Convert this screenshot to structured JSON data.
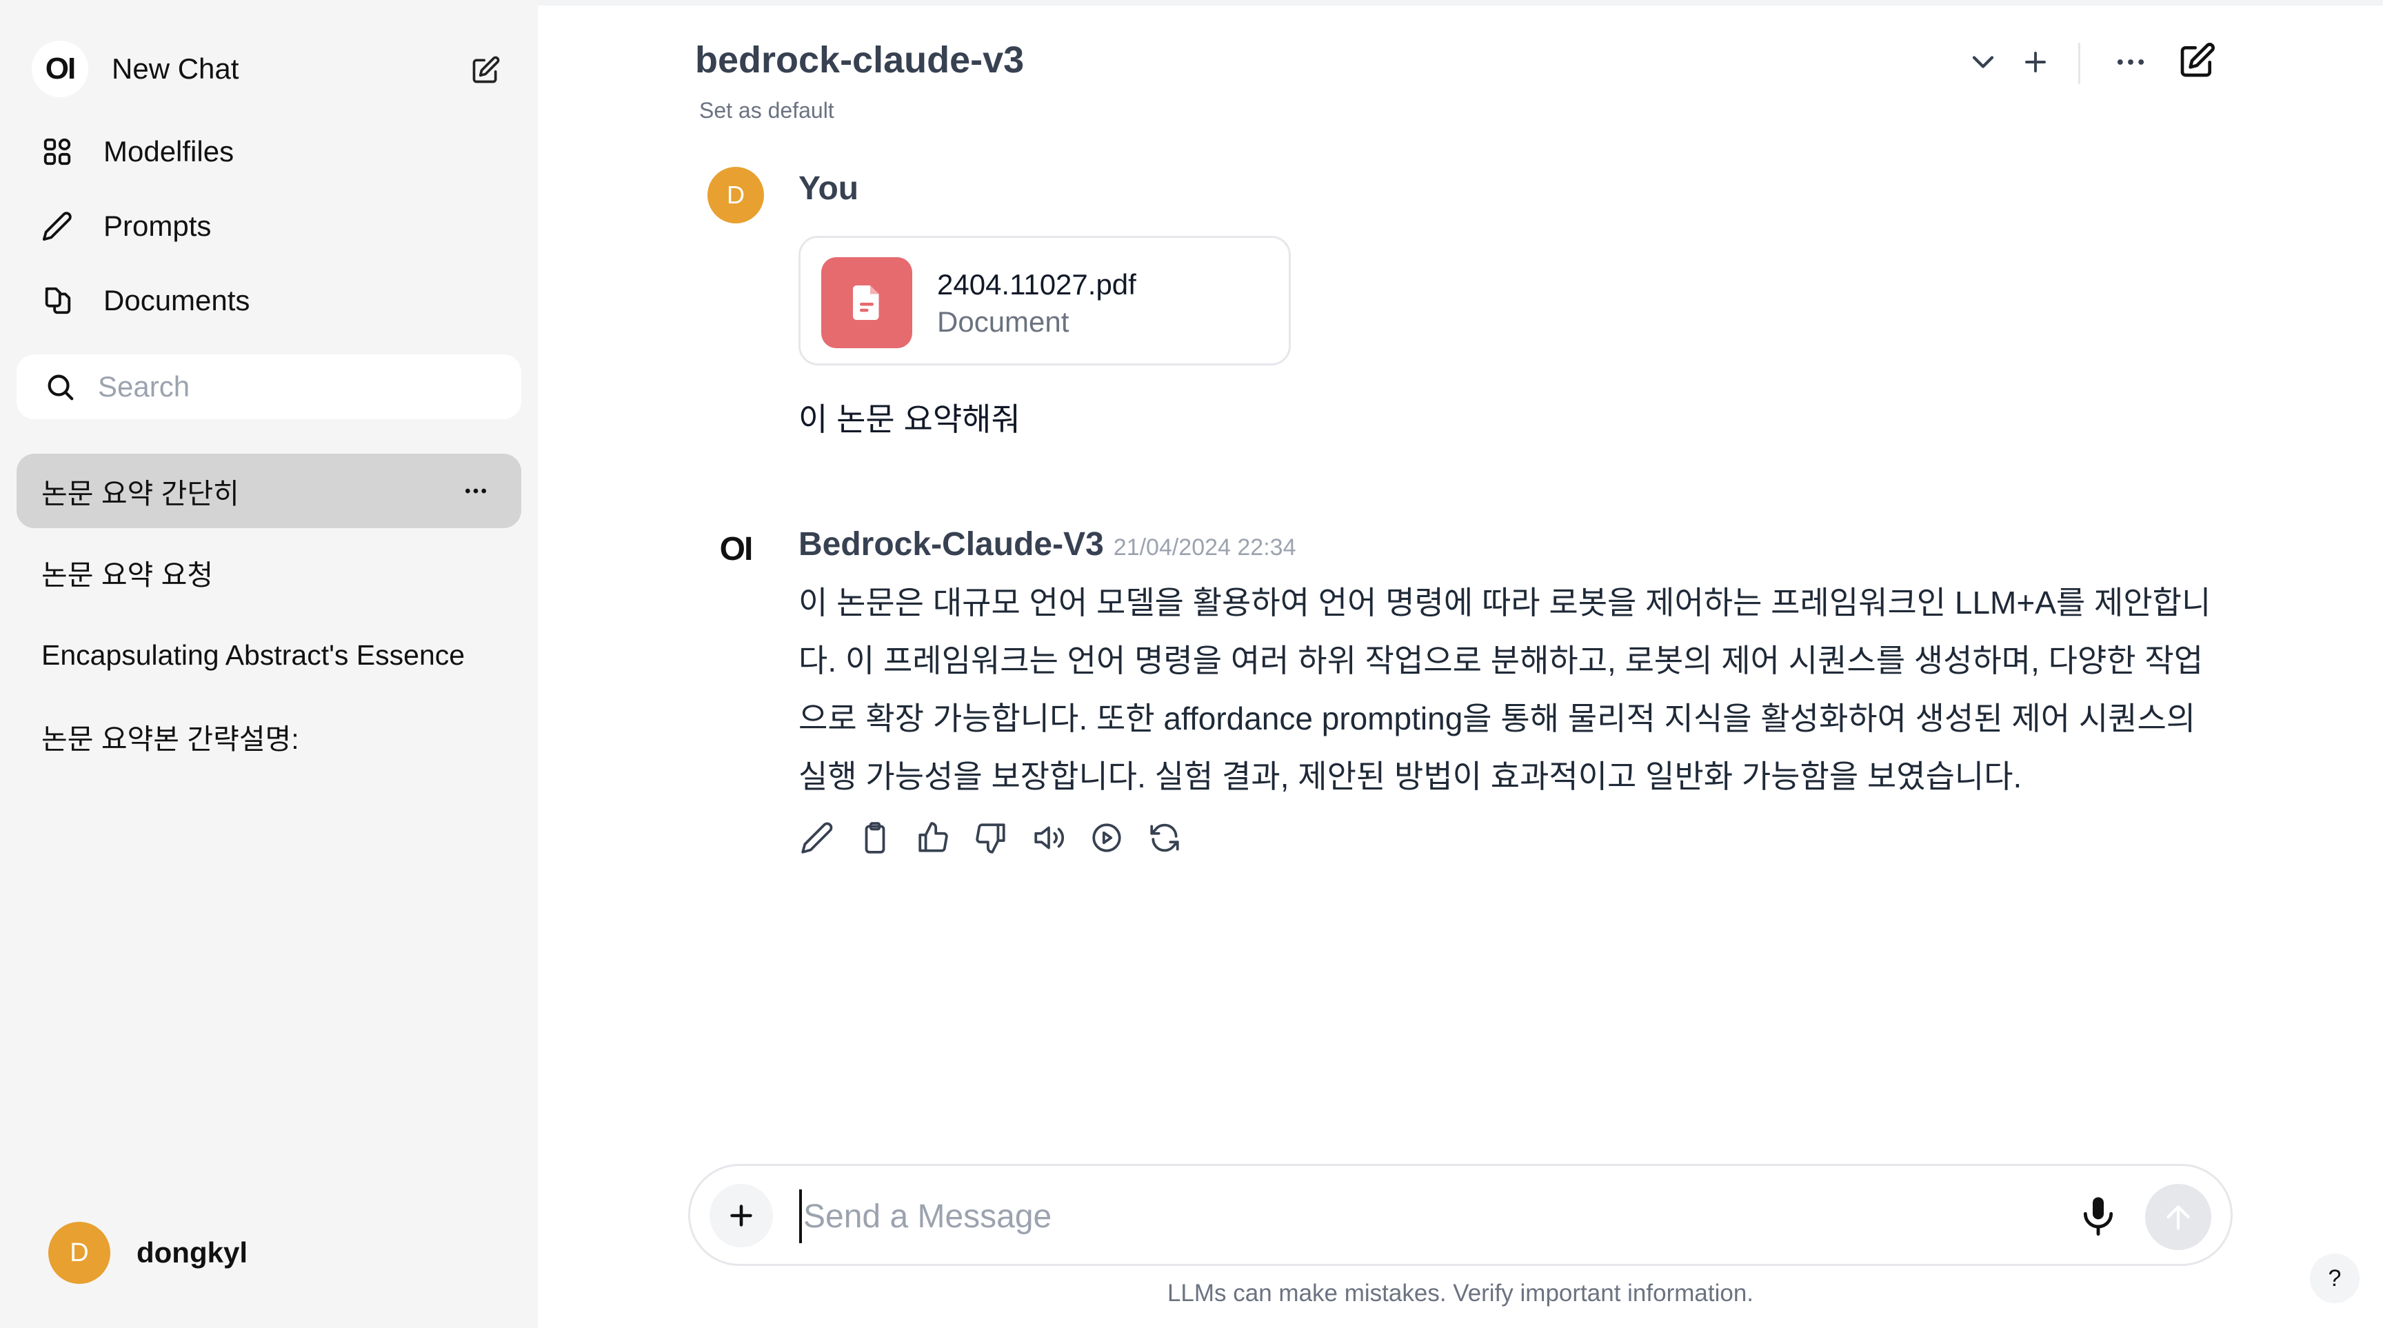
{
  "sidebar": {
    "logo_text": "OI",
    "new_chat_label": "New Chat",
    "nav": [
      {
        "label": "Modelfiles",
        "icon": "modelfiles-icon"
      },
      {
        "label": "Prompts",
        "icon": "pencil-icon"
      },
      {
        "label": "Documents",
        "icon": "documents-icon"
      }
    ],
    "search_placeholder": "Search",
    "chats": [
      {
        "title": "논문 요약 간단히",
        "active": true
      },
      {
        "title": "논문 요약 요청",
        "active": false
      },
      {
        "title": "Encapsulating Abstract's Essence",
        "active": false
      },
      {
        "title": "논문 요약본 간략설명:",
        "active": false
      }
    ],
    "user": {
      "initial": "D",
      "name": "dongkyl"
    }
  },
  "header": {
    "model_name": "bedrock-claude-v3",
    "set_default": "Set as default"
  },
  "messages": {
    "user": {
      "initial": "D",
      "author": "You",
      "file": {
        "name": "2404.11027.pdf",
        "type": "Document"
      },
      "text": "이 논문 요약해줘"
    },
    "assistant": {
      "logo_text": "OI",
      "author": "Bedrock-Claude-V3",
      "timestamp": "21/04/2024 22:34",
      "lines": [
        "이 논문은 대규모 언어 모델을 활용하여 언어 명령에 따라 로봇을 제어하는 프레임워크인 LLM+A를 제안합니",
        "다. 이 프레임워크는 언어 명령을 여러 하위 작업으로 분해하고, 로봇의 제어 시퀀스를 생성하며, 다양한 작업",
        "으로 확장 가능합니다. 또한 affordance prompting을 통해 물리적 지식을 활성화하여 생성된 제어 시퀀스의",
        "실행 가능성을 보장합니다. 실험 결과, 제안된 방법이 효과적이고 일반화 가능함을 보였습니다."
      ]
    }
  },
  "input": {
    "placeholder": "Send a Message",
    "value": ""
  },
  "footer": {
    "disclaimer": "LLMs can make mistakes. Verify important information.",
    "help_label": "?"
  },
  "colors": {
    "sidebar_bg": "#f5f5f5",
    "active_chat_bg": "#d4d4d4",
    "avatar_bg": "#e8a030",
    "file_icon_bg": "#e56b6f"
  }
}
